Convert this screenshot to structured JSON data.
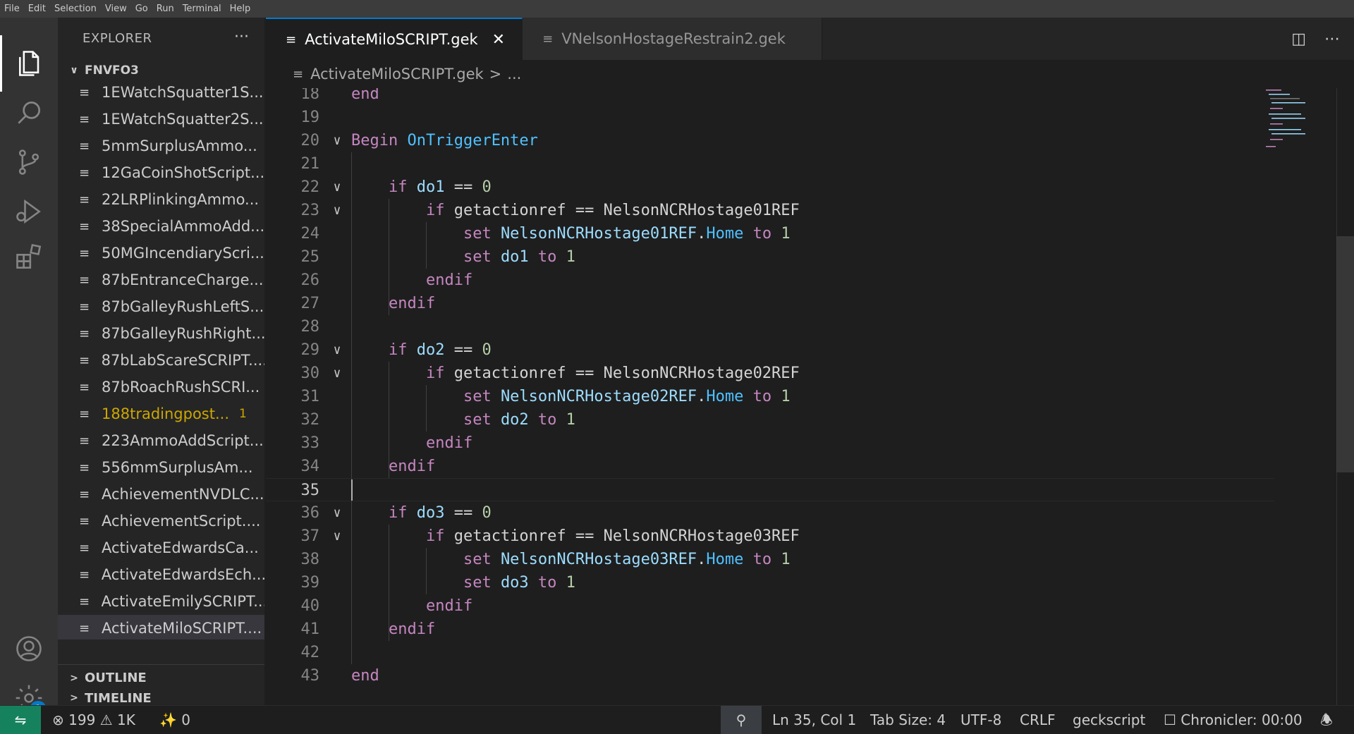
{
  "menu": [
    "File",
    "Edit",
    "Selection",
    "View",
    "Go",
    "Run",
    "Terminal",
    "Help"
  ],
  "activity_bar": {
    "icons": [
      "files-icon",
      "search-icon",
      "source-control-icon",
      "run-debug-icon",
      "extensions-icon",
      "account-icon",
      "settings-gear-icon"
    ],
    "settings_badge": "1"
  },
  "sidebar": {
    "title": "EXPLORER",
    "more": "···",
    "folder": "FNVFO3",
    "files": [
      {
        "name": "1EWatchSquatter1S..."
      },
      {
        "name": "1EWatchSquatter2S..."
      },
      {
        "name": "5mmSurplusAmmo..."
      },
      {
        "name": "12GaCoinShotScript..."
      },
      {
        "name": "22LRPlinkingAmmo..."
      },
      {
        "name": "38SpecialAmmoAdd..."
      },
      {
        "name": "50MGIncendiaryScri..."
      },
      {
        "name": "87bEntranceCharge..."
      },
      {
        "name": "87bGalleyRushLeftS..."
      },
      {
        "name": "87bGalleyRushRight..."
      },
      {
        "name": "87bLabScareSCRIPT...."
      },
      {
        "name": "87bRoachRushSCRI..."
      },
      {
        "name": "188tradingpost...",
        "badge": "1",
        "modified": true
      },
      {
        "name": "223AmmoAddScript..."
      },
      {
        "name": "556mmSurplusAm..."
      },
      {
        "name": "AchievementNVDLC..."
      },
      {
        "name": "AchievementScript...."
      },
      {
        "name": "ActivateEdwardsCa..."
      },
      {
        "name": "ActivateEdwardsEch..."
      },
      {
        "name": "ActivateEmilySCRIPT..."
      },
      {
        "name": "ActivateMiloSCRIPT....",
        "selected": true
      }
    ],
    "outline_label": "OUTLINE",
    "timeline_label": "TIMELINE"
  },
  "tabs": [
    {
      "label": "ActivateMiloSCRIPT.gek",
      "active": true,
      "close": "✕"
    },
    {
      "label": "VNelsonHostageRestrain2.gek",
      "active": false
    }
  ],
  "breadcrumb": {
    "file": "ActivateMiloSCRIPT.gek",
    "sep": ">",
    "rest": "..."
  },
  "editor": {
    "lines": [
      {
        "n": "18",
        "tokens": [
          [
            "kw",
            "end"
          ]
        ]
      },
      {
        "n": "19",
        "tokens": []
      },
      {
        "n": "20",
        "fold": true,
        "tokens": [
          [
            "kw",
            "Begin "
          ],
          [
            "fn",
            "OnTriggerEnter"
          ]
        ]
      },
      {
        "n": "21",
        "tokens": []
      },
      {
        "n": "22",
        "fold": true,
        "tokens": [
          [
            "txt",
            "    "
          ],
          [
            "kw",
            "if "
          ],
          [
            "id",
            "do1"
          ],
          [
            "txt",
            " == "
          ],
          [
            "num",
            "0"
          ]
        ]
      },
      {
        "n": "23",
        "fold": true,
        "tokens": [
          [
            "txt",
            "        "
          ],
          [
            "kw",
            "if "
          ],
          [
            "txt",
            "getactionref == NelsonNCRHostage01REF"
          ]
        ]
      },
      {
        "n": "24",
        "tokens": [
          [
            "txt",
            "            "
          ],
          [
            "kw",
            "set "
          ],
          [
            "id",
            "NelsonNCRHostage01REF"
          ],
          [
            "txt",
            "."
          ],
          [
            "fn",
            "Home"
          ],
          [
            "kw",
            " to "
          ],
          [
            "num",
            "1"
          ]
        ]
      },
      {
        "n": "25",
        "tokens": [
          [
            "txt",
            "            "
          ],
          [
            "kw",
            "set "
          ],
          [
            "id",
            "do1"
          ],
          [
            "kw",
            " to "
          ],
          [
            "num",
            "1"
          ]
        ]
      },
      {
        "n": "26",
        "tokens": [
          [
            "txt",
            "        "
          ],
          [
            "kw",
            "endif"
          ]
        ]
      },
      {
        "n": "27",
        "tokens": [
          [
            "txt",
            "    "
          ],
          [
            "kw",
            "endif"
          ]
        ]
      },
      {
        "n": "28",
        "tokens": []
      },
      {
        "n": "29",
        "fold": true,
        "tokens": [
          [
            "txt",
            "    "
          ],
          [
            "kw",
            "if "
          ],
          [
            "id",
            "do2"
          ],
          [
            "txt",
            " == "
          ],
          [
            "num",
            "0"
          ]
        ]
      },
      {
        "n": "30",
        "fold": true,
        "tokens": [
          [
            "txt",
            "        "
          ],
          [
            "kw",
            "if "
          ],
          [
            "txt",
            "getactionref == NelsonNCRHostage02REF"
          ]
        ]
      },
      {
        "n": "31",
        "tokens": [
          [
            "txt",
            "            "
          ],
          [
            "kw",
            "set "
          ],
          [
            "id",
            "NelsonNCRHostage02REF"
          ],
          [
            "txt",
            "."
          ],
          [
            "fn",
            "Home"
          ],
          [
            "kw",
            " to "
          ],
          [
            "num",
            "1"
          ]
        ]
      },
      {
        "n": "32",
        "tokens": [
          [
            "txt",
            "            "
          ],
          [
            "kw",
            "set "
          ],
          [
            "id",
            "do2"
          ],
          [
            "kw",
            " to "
          ],
          [
            "num",
            "1"
          ]
        ]
      },
      {
        "n": "33",
        "tokens": [
          [
            "txt",
            "        "
          ],
          [
            "kw",
            "endif"
          ]
        ]
      },
      {
        "n": "34",
        "tokens": [
          [
            "txt",
            "    "
          ],
          [
            "kw",
            "endif"
          ]
        ]
      },
      {
        "n": "35",
        "current": true,
        "tokens": []
      },
      {
        "n": "36",
        "fold": true,
        "tokens": [
          [
            "txt",
            "    "
          ],
          [
            "kw",
            "if "
          ],
          [
            "id",
            "do3"
          ],
          [
            "txt",
            " == "
          ],
          [
            "num",
            "0"
          ]
        ]
      },
      {
        "n": "37",
        "fold": true,
        "tokens": [
          [
            "txt",
            "        "
          ],
          [
            "kw",
            "if "
          ],
          [
            "txt",
            "getactionref == NelsonNCRHostage03REF"
          ]
        ]
      },
      {
        "n": "38",
        "tokens": [
          [
            "txt",
            "            "
          ],
          [
            "kw",
            "set "
          ],
          [
            "id",
            "NelsonNCRHostage03REF"
          ],
          [
            "txt",
            "."
          ],
          [
            "fn",
            "Home"
          ],
          [
            "kw",
            " to "
          ],
          [
            "num",
            "1"
          ]
        ]
      },
      {
        "n": "39",
        "tokens": [
          [
            "txt",
            "            "
          ],
          [
            "kw",
            "set "
          ],
          [
            "id",
            "do3"
          ],
          [
            "kw",
            " to "
          ],
          [
            "num",
            "1"
          ]
        ]
      },
      {
        "n": "40",
        "tokens": [
          [
            "txt",
            "        "
          ],
          [
            "kw",
            "endif"
          ]
        ]
      },
      {
        "n": "41",
        "tokens": [
          [
            "txt",
            "    "
          ],
          [
            "kw",
            "endif"
          ]
        ]
      },
      {
        "n": "42",
        "tokens": []
      },
      {
        "n": "43",
        "tokens": [
          [
            "kw",
            "end"
          ]
        ]
      }
    ]
  },
  "statusbar": {
    "errors": "199",
    "warnings": "1K",
    "ports": "0",
    "position": "Ln 35, Col 1",
    "tab_size": "Tab Size: 4",
    "encoding": "UTF-8",
    "eol": "CRLF",
    "language": "geckscript",
    "chronicler": "Chronicler: 00:00"
  },
  "colors": {
    "accent": "#007acc",
    "remote": "#16825d",
    "keyword": "#c586c0",
    "variable": "#9cdcfe",
    "function": "#4fc1ff",
    "number": "#b5cea8",
    "modified": "#cca700"
  }
}
